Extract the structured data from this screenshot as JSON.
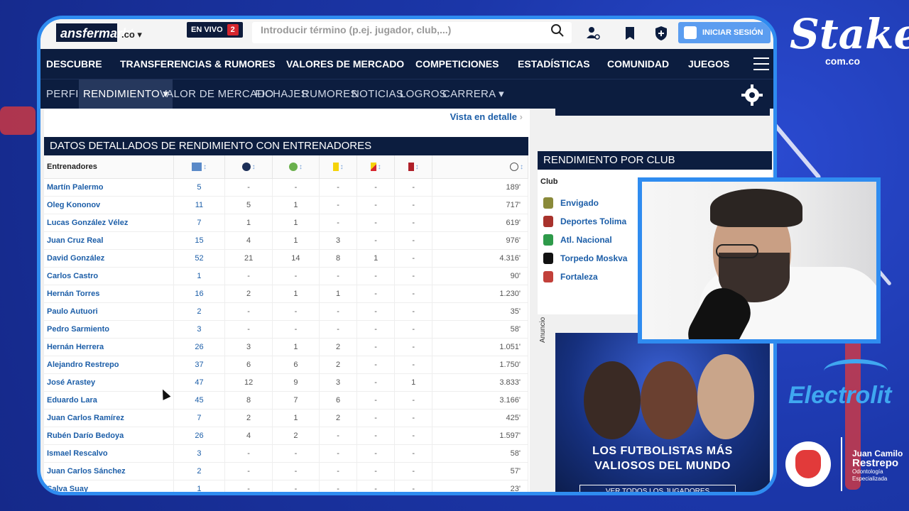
{
  "topbar": {
    "logo": "ansfermarkt",
    "tld": ".co",
    "live_label": "EN VIVO",
    "live_count": "2",
    "search_placeholder": "Introducir término (p.ej. jugador, club,...)",
    "login_label": "INICIAR SESIÓN"
  },
  "mainnav": [
    "DESCUBRE",
    "TRANSFERENCIAS & RUMORES",
    "VALORES DE MERCADO",
    "COMPETICIONES",
    "ESTADÍSTICAS",
    "COMUNIDAD",
    "JUEGOS"
  ],
  "subnav": {
    "items": [
      "PERFIL",
      "RENDIMIENTO",
      "VALOR DE MERCADO",
      "FICHAJES",
      "RUMORES",
      "NOTICIAS",
      "LOGROS",
      "CARRERA"
    ],
    "active": "RENDIMIENTO"
  },
  "content": {
    "detail_link": "Vista en detalle",
    "section_title": "DATOS DETALLADOS DE RENDIMIENTO CON ENTRENADORES",
    "table": {
      "name_header": "Entrenadores",
      "column_icons": [
        "appearances-icon",
        "goals-icon",
        "assists-icon",
        "yellow-card-icon",
        "yellow-red-card-icon",
        "red-card-icon",
        "minutes-icon"
      ],
      "rows": [
        [
          "Martín Palermo",
          "5",
          "-",
          "-",
          "-",
          "-",
          "-",
          "189'"
        ],
        [
          "Oleg Kononov",
          "11",
          "5",
          "1",
          "-",
          "-",
          "-",
          "717'"
        ],
        [
          "Lucas González Vélez",
          "7",
          "1",
          "1",
          "-",
          "-",
          "-",
          "619'"
        ],
        [
          "Juan Cruz Real",
          "15",
          "4",
          "1",
          "3",
          "-",
          "-",
          "976'"
        ],
        [
          "David González",
          "52",
          "21",
          "14",
          "8",
          "1",
          "-",
          "4.316'"
        ],
        [
          "Carlos Castro",
          "1",
          "-",
          "-",
          "-",
          "-",
          "-",
          "90'"
        ],
        [
          "Hernán Torres",
          "16",
          "2",
          "1",
          "1",
          "-",
          "-",
          "1.230'"
        ],
        [
          "Paulo Autuori",
          "2",
          "-",
          "-",
          "-",
          "-",
          "-",
          "35'"
        ],
        [
          "Pedro Sarmiento",
          "3",
          "-",
          "-",
          "-",
          "-",
          "-",
          "58'"
        ],
        [
          "Hernán Herrera",
          "26",
          "3",
          "1",
          "2",
          "-",
          "-",
          "1.051'"
        ],
        [
          "Alejandro Restrepo",
          "37",
          "6",
          "6",
          "2",
          "-",
          "-",
          "1.750'"
        ],
        [
          "José Arastey",
          "47",
          "12",
          "9",
          "3",
          "-",
          "1",
          "3.833'"
        ],
        [
          "Eduardo Lara",
          "45",
          "8",
          "7",
          "6",
          "-",
          "-",
          "3.166'"
        ],
        [
          "Juan Carlos Ramírez",
          "7",
          "2",
          "1",
          "2",
          "-",
          "-",
          "425'"
        ],
        [
          "Rubén Darío Bedoya",
          "26",
          "4",
          "2",
          "-",
          "-",
          "-",
          "1.597'"
        ],
        [
          "Ismael Rescalvo",
          "3",
          "-",
          "-",
          "-",
          "-",
          "-",
          "58'"
        ],
        [
          "Juan Carlos Sánchez",
          "2",
          "-",
          "-",
          "-",
          "-",
          "-",
          "57'"
        ],
        [
          "Salva Suay",
          "1",
          "-",
          "-",
          "-",
          "-",
          "-",
          "23'"
        ]
      ]
    }
  },
  "club_panel": {
    "title": "RENDIMIENTO POR CLUB",
    "col_header": "Club",
    "clubs": [
      {
        "name": "Envigado",
        "color": "#8a8a3a"
      },
      {
        "name": "Deportes Tolima",
        "color": "#a8322c"
      },
      {
        "name": "Atl. Nacional",
        "color": "#2e9a4a"
      },
      {
        "name": "Torpedo Moskva",
        "color": "#111111"
      },
      {
        "name": "Fortaleza",
        "color": "#c2403a"
      }
    ]
  },
  "ad": {
    "label": "Anuncio",
    "headline_1": "LOS FUTBOLISTAS MÁS",
    "headline_2": "VALIOSOS DEL MUNDO",
    "button": "VER TODOS LOS JUGADORES"
  },
  "branding": {
    "stake": "Stake",
    "stake_sub": "com.co",
    "electrolit": "Electrolit",
    "dentist_first": "Juan Camilo",
    "dentist_last": "Restrepo",
    "dentist_line1": "Odontología",
    "dentist_line2": "Especializada"
  },
  "colors": {
    "nav_bg": "#0c1d3f",
    "link": "#1c5ea8",
    "frame": "#2f8cf0",
    "accent_red": "#d6262e"
  }
}
